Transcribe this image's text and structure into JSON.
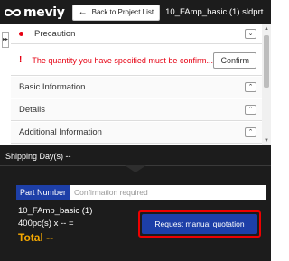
{
  "header": {
    "logo_text": "meviy",
    "back_button_label": "Back to Project List",
    "back_arrow": "←",
    "filename": "10_FAmp_basic (1).sldprt"
  },
  "side_toggle": "▸▸",
  "panel": {
    "precaution_label": "Precaution",
    "warning_mark": "!",
    "warning_text": "The quantity you have specified must be confirm...",
    "confirm_label": "Confirm",
    "sections": [
      {
        "label": "Basic Information"
      },
      {
        "label": "Details"
      },
      {
        "label": "Additional Information"
      }
    ],
    "chevron_down": "⌄",
    "chevron_up": "⌃"
  },
  "bottom": {
    "shipping": "Shipping Day(s) --",
    "part_number_label": "Part Number",
    "part_number_placeholder": "Confirmation required",
    "part_name": "10_FAmp_basic (1)",
    "quantity": "400pc(s)  x -- =",
    "total": "Total --",
    "request_button": "Request manual quotation"
  },
  "colors": {
    "accent_red": "#e60012",
    "brand_blue": "#1d3fa8",
    "total_orange": "#f5a800",
    "dark_bg": "#1c1c1c"
  }
}
